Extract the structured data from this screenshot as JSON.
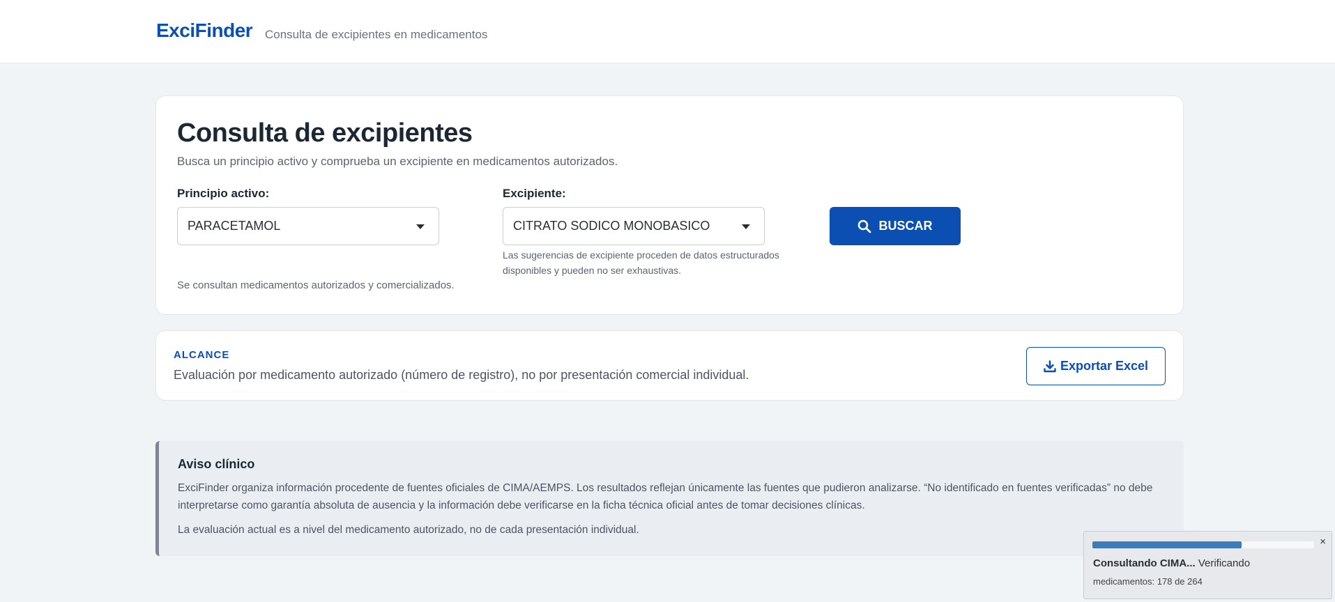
{
  "header": {
    "brand": "ExciFinder",
    "tagline": "Consulta de excipientes en medicamentos"
  },
  "search": {
    "title": "Consulta de excipientes",
    "subtitle": "Busca un principio activo y comprueba un excipiente en medicamentos autorizados.",
    "active_label": "Principio activo:",
    "active_value": "PARACETAMOL",
    "excipient_label": "Excipiente:",
    "excipient_value": "CITRATO SODICO MONOBASICO",
    "excipient_hint": "Las sugerencias de excipiente proceden de datos estructurados disponibles y pueden no ser exhaustivas.",
    "search_button": "BUSCAR",
    "note": "Se consultan medicamentos autorizados y comercializados."
  },
  "scope": {
    "kicker": "ALCANCE",
    "text": "Evaluación por medicamento autorizado (número de registro), no por presentación comercial individual.",
    "export_button": "Exportar Excel"
  },
  "notice": {
    "title": "Aviso clínico",
    "paragraph1": "ExciFinder organiza información procedente de fuentes oficiales de CIMA/AEMPS. Los resultados reflejan únicamente las fuentes que pudieron analizarse. “No identificado en fuentes verificadas” no debe interpretarse como garantía absoluta de ausencia y la información debe verificarse en la ficha técnica oficial antes de tomar decisiones clínicas.",
    "paragraph2": "La evaluación actual es a nivel del medicamento autorizado, no de cada presentación individual."
  },
  "toast": {
    "close": "×",
    "status_bold": "Consultando CIMA...",
    "status_rest": "Verificando",
    "progress_text": "medicamentos: 178 de 264",
    "progress_fraction": 0.674
  },
  "colors": {
    "brand": "#0b4fb3",
    "background": "#f1f4f7",
    "progress": "#3e7cb9"
  },
  "icons": {
    "search_button_icon": "search-icon",
    "export_icon": "download-icon",
    "select_caret": "caret-down-icon"
  }
}
